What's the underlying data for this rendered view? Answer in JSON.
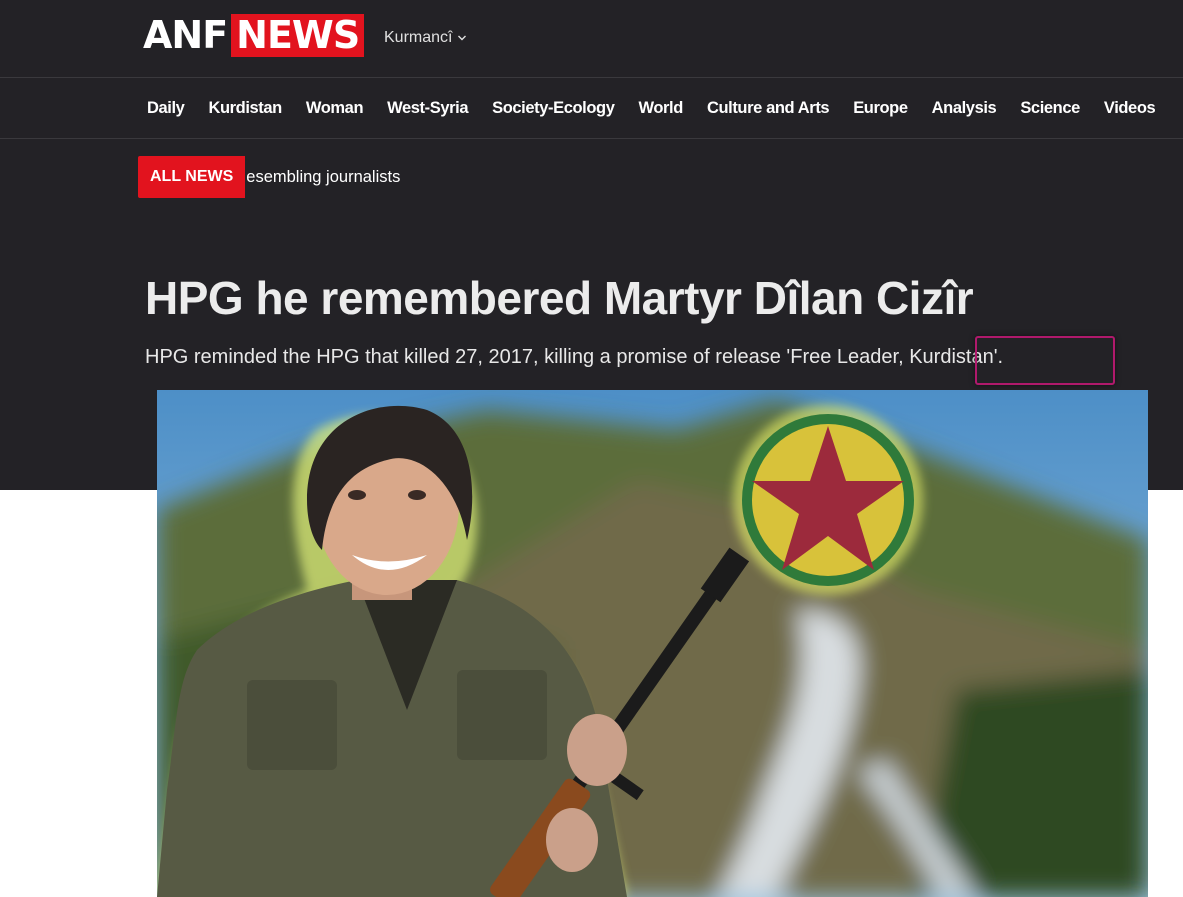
{
  "brand": {
    "logo_left": "ANF",
    "logo_right": "NEWS",
    "accent": "#e2131e"
  },
  "language": {
    "label": "Kurmancî"
  },
  "nav": {
    "items": [
      "Daily",
      "Kurdistan",
      "Woman",
      "West-Syria",
      "Society-Ecology",
      "World",
      "Culture and Arts",
      "Europe",
      "Analysis",
      "Science",
      "Videos"
    ]
  },
  "ticker": {
    "badge": "ALL NEWS",
    "text": "esembling journalists"
  },
  "article": {
    "title": "HPG he remembered Martyr Dîlan Cizîr",
    "summary": "HPG reminded the HPG that killed 27, 2017, killing a promise of release 'Free Leader, Kurdistan'."
  },
  "hero_image": {
    "icon": "photo-icon"
  }
}
